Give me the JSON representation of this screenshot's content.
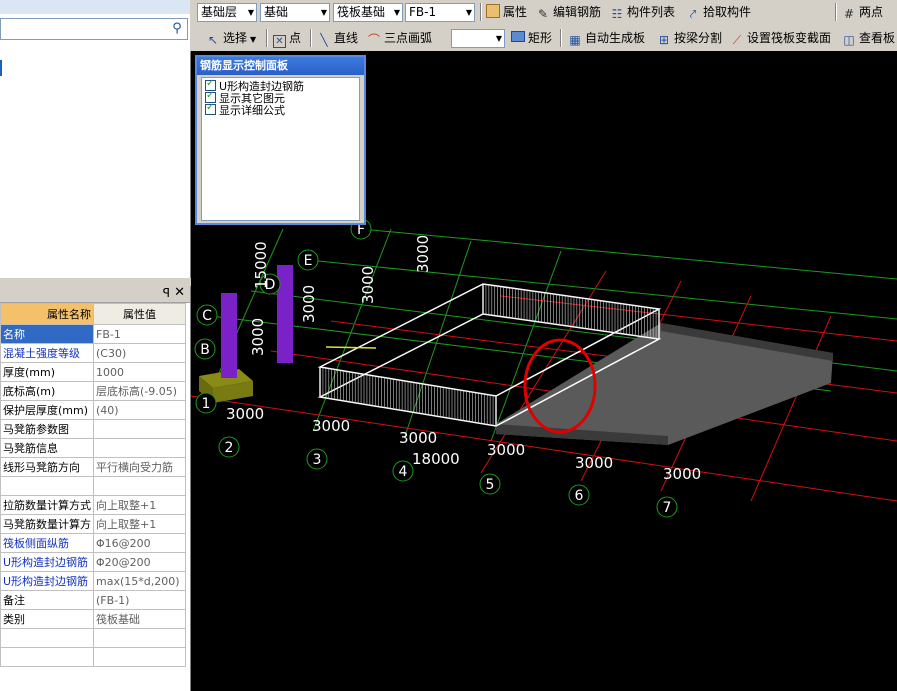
{
  "toolbar1": {
    "floor": "基础层",
    "category": "基础",
    "type": "筏板基础",
    "element": "FB-1",
    "properties_label": "属性",
    "edit_rebar_label": "编辑钢筋",
    "component_list_label": "构件列表",
    "pick_component_label": "拾取构件",
    "two_point_label": "两点"
  },
  "toolbar2": {
    "select_label": "选择",
    "point_label": "点",
    "line_label": "直线",
    "arc_label": "三点画弧",
    "arc_combo_value": "",
    "rect_label": "矩形",
    "auto_generate_label": "自动生成板",
    "split_by_beam_label": "按梁分割",
    "set_slope_label": "设置筏板变截面",
    "view_slab_label": "查看板"
  },
  "rebar_panel": {
    "title": "钢筋显示控制面板",
    "options": [
      "U形构造封边钢筋",
      "显示其它图元",
      "显示详细公式"
    ]
  },
  "property_panel": {
    "pin": "ꟼ",
    "close": "✕",
    "header_name": "属性名称",
    "header_value": "属性值",
    "rows": [
      {
        "name": "名称",
        "value": "FB-1",
        "blue": false
      },
      {
        "name": "混凝土强度等级",
        "value": "(C30)",
        "blue": true
      },
      {
        "name": "厚度(mm)",
        "value": "1000",
        "blue": false
      },
      {
        "name": "底标高(m)",
        "value": "层底标高(-9.05)",
        "blue": false
      },
      {
        "name": "保护层厚度(mm)",
        "value": "(40)",
        "blue": false
      },
      {
        "name": "马凳筋参数图",
        "value": "",
        "blue": false
      },
      {
        "name": "马凳筋信息",
        "value": "",
        "blue": false
      },
      {
        "name": "线形马凳筋方向",
        "value": "平行横向受力筋",
        "blue": false
      },
      {
        "name": "",
        "value": "",
        "blue": false
      },
      {
        "name": "拉筋数量计算方式",
        "value": "向上取整+1",
        "blue": false
      },
      {
        "name": "马凳筋数量计算方",
        "value": "向上取整+1",
        "blue": false
      },
      {
        "name": "筏板侧面纵筋",
        "value": "Φ16@200",
        "blue": true
      },
      {
        "name": "U形构造封边钢筋",
        "value": "Φ20@200",
        "blue": true
      },
      {
        "name": "U形构造封边钢筋",
        "value": "max(15*d,200)",
        "blue": true
      },
      {
        "name": "备注",
        "value": "(FB-1)",
        "blue": false
      },
      {
        "name": "类别",
        "value": "筏板基础",
        "blue": false
      },
      {
        "name": "",
        "value": "",
        "blue": false
      },
      {
        "name": "",
        "value": "",
        "blue": false
      }
    ]
  },
  "viewport": {
    "grid_letters": [
      "F",
      "E",
      "D",
      "C",
      "B"
    ],
    "grid_numbers": [
      "1",
      "2",
      "3",
      "4",
      "5",
      "6",
      "7"
    ],
    "dims_bottom": [
      "3000",
      "3000",
      "3000",
      "3000",
      "3000",
      "3000"
    ],
    "dim_total": "18000",
    "dims_side": [
      "3000",
      "3000",
      "3000",
      "15000",
      "3000"
    ]
  }
}
